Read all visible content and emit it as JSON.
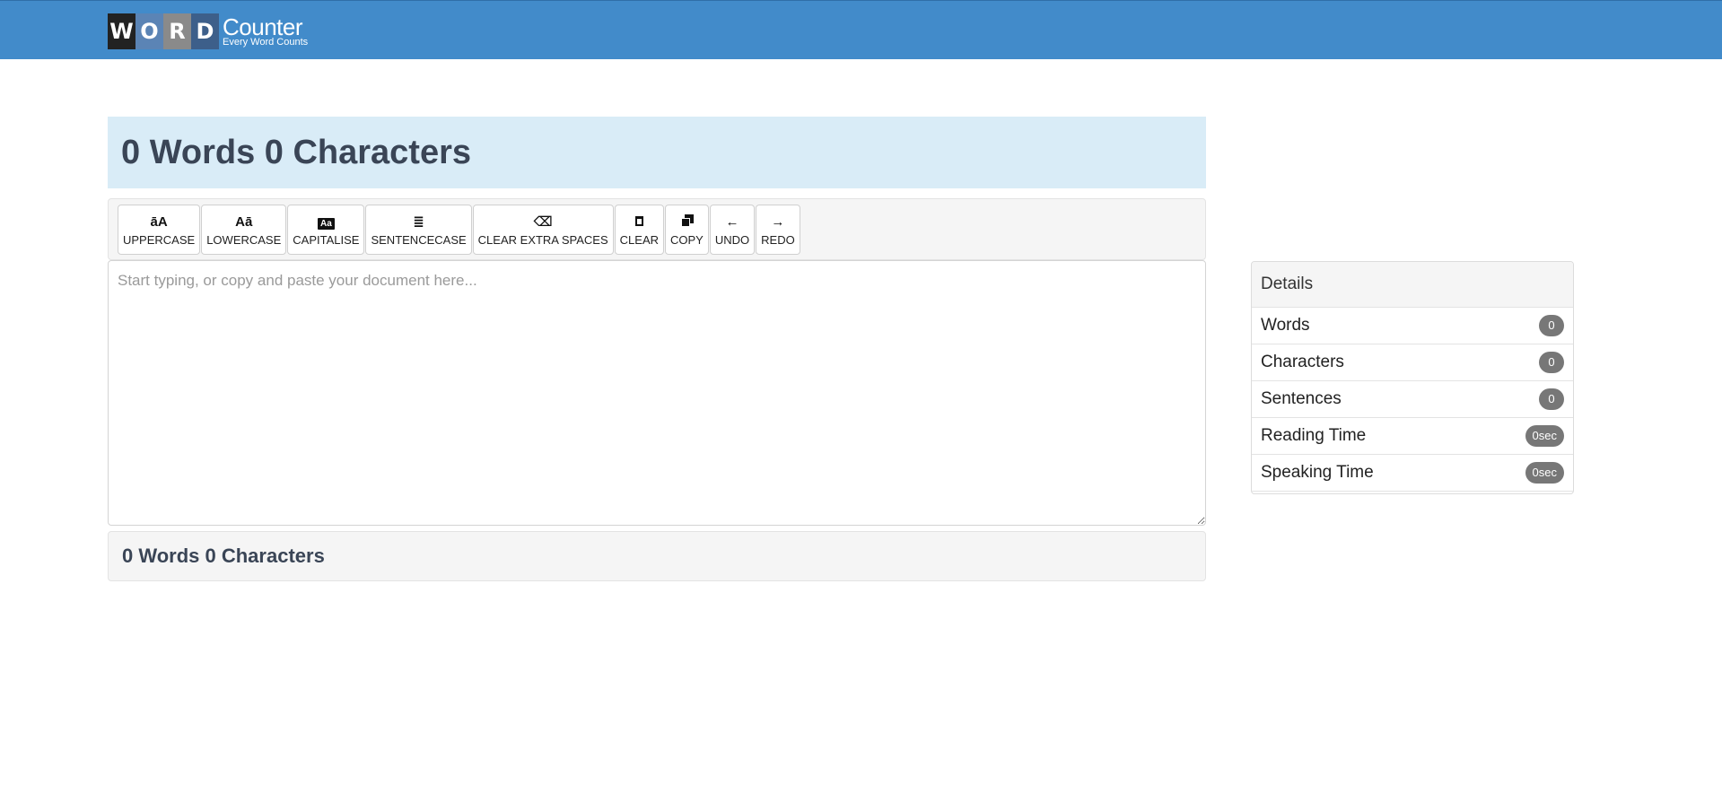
{
  "header": {
    "logo_letters": [
      "W",
      "O",
      "R",
      "D"
    ],
    "logo_word": "Counter",
    "tagline": "Every Word Counts"
  },
  "headline": "0 Words 0 Characters",
  "toolbar": {
    "buttons": [
      {
        "label": "UPPERCASE",
        "icon": "āA"
      },
      {
        "label": "LOWERCASE",
        "icon": "Aā"
      },
      {
        "label": "CAPITALISE",
        "icon": "Aa"
      },
      {
        "label": "SENTENCECASE",
        "icon": "≣"
      },
      {
        "label": "CLEAR EXTRA SPACES",
        "icon": "⌫"
      },
      {
        "label": "CLEAR",
        "icon": "trash-icon"
      },
      {
        "label": "COPY",
        "icon": "copy-icon"
      },
      {
        "label": "UNDO",
        "icon": "←"
      },
      {
        "label": "REDO",
        "icon": "→"
      }
    ]
  },
  "editor": {
    "value": "",
    "placeholder": "Start typing, or copy and paste your document here..."
  },
  "footer_count": "0 Words 0 Characters",
  "details": {
    "title": "Details",
    "rows": [
      {
        "label": "Words",
        "value": "0"
      },
      {
        "label": "Characters",
        "value": "0"
      },
      {
        "label": "Sentences",
        "value": "0"
      },
      {
        "label": "Reading Time",
        "value": "0sec"
      },
      {
        "label": "Speaking Time",
        "value": "0sec"
      }
    ]
  },
  "colors": {
    "topbar": "#428bca",
    "headline_bg": "#d9ecf7",
    "badge": "#777777"
  }
}
